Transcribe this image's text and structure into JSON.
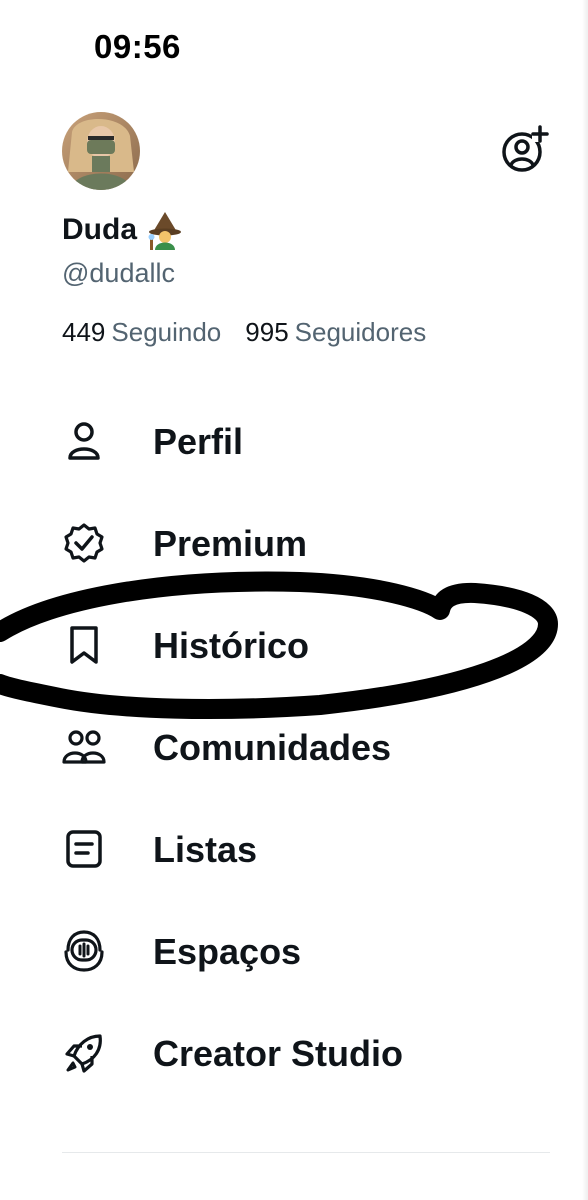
{
  "status_bar": {
    "time": "09:56"
  },
  "profile": {
    "display_name": "Duda",
    "name_emoji": "mage-emoji",
    "handle": "@dudallc",
    "following_count": "449",
    "following_label": "Seguindo",
    "followers_count": "995",
    "followers_label": "Seguidores"
  },
  "menu": [
    {
      "label": "Perfil",
      "icon": "person-icon"
    },
    {
      "label": "Premium",
      "icon": "verified-badge-icon"
    },
    {
      "label": "Histórico",
      "icon": "bookmark-icon"
    },
    {
      "label": "Comunidades",
      "icon": "communities-icon"
    },
    {
      "label": "Listas",
      "icon": "list-icon"
    },
    {
      "label": "Espaços",
      "icon": "spaces-icon"
    },
    {
      "label": "Creator Studio",
      "icon": "rocket-icon"
    }
  ],
  "colors": {
    "text_primary": "#0f1419",
    "text_secondary": "#536471",
    "annotation_scribble": "#000000"
  }
}
